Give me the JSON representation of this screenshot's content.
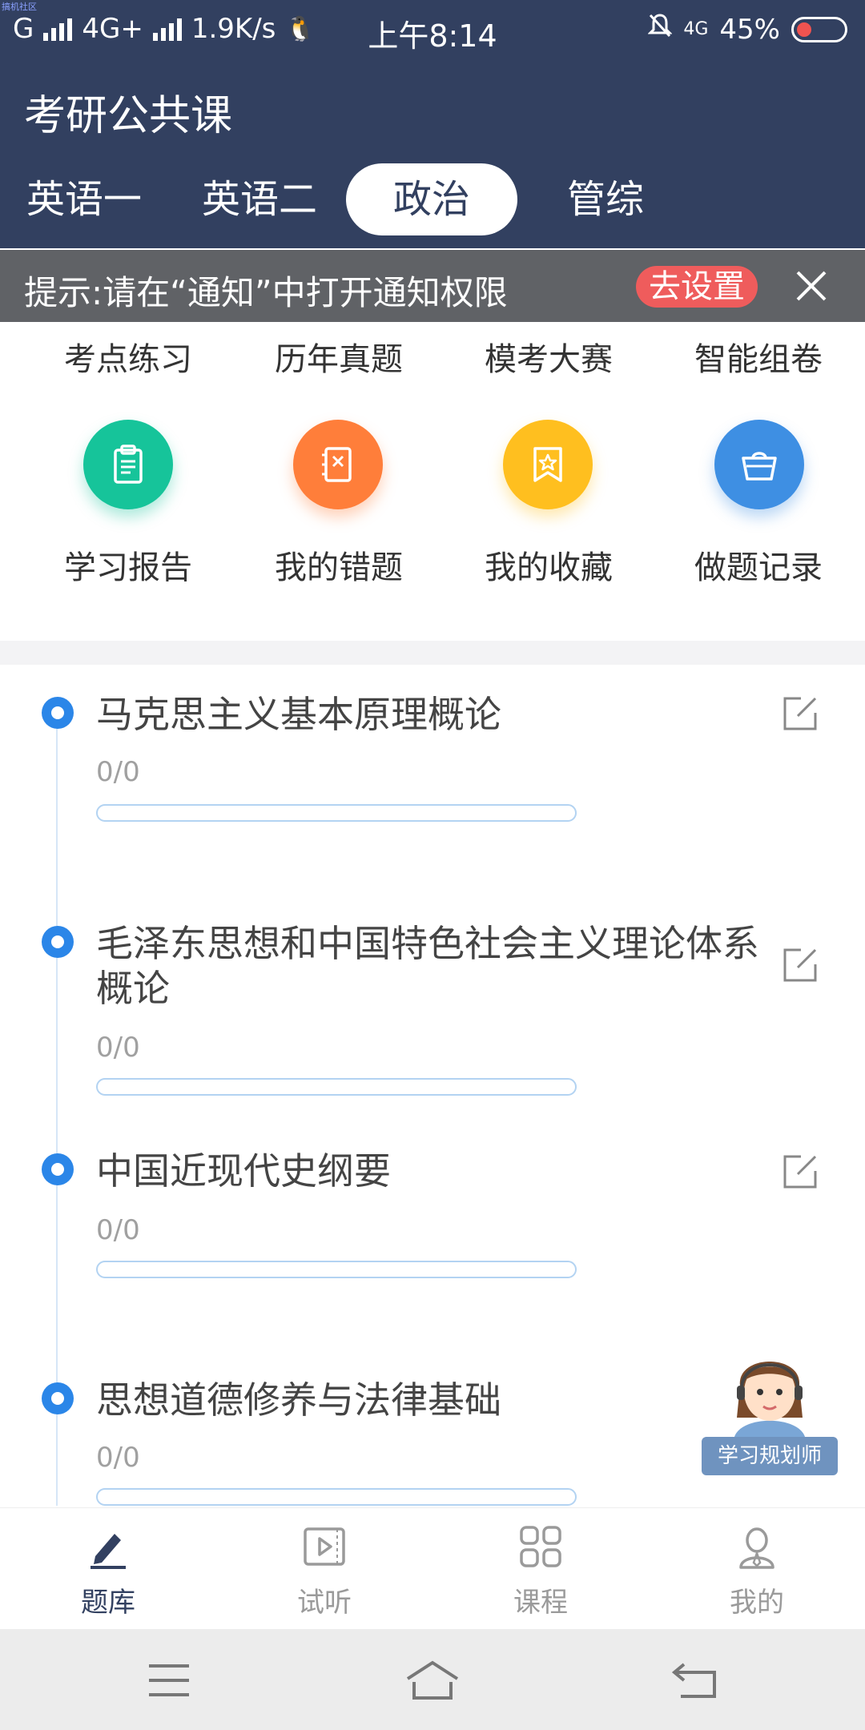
{
  "status_bar": {
    "watermark": "搞机社区",
    "carrier": "G",
    "network": "4G+",
    "speed": "1.9K/s",
    "time": "上午8:14",
    "net_type": "4G",
    "battery": "45%"
  },
  "header": {
    "title": "考研公共课",
    "tabs": [
      {
        "label": "英语一",
        "active": false
      },
      {
        "label": "英语二",
        "active": false
      },
      {
        "label": "政治",
        "active": true
      },
      {
        "label": "管综",
        "active": false
      }
    ]
  },
  "notice": {
    "text": "提示:请在“通知”中打开通知权限",
    "button": "去设置",
    "close_icon": "close-icon"
  },
  "quick_menu": {
    "top_row": [
      "考点练习",
      "历年真题",
      "模考大赛",
      "智能组卷"
    ],
    "items": [
      {
        "label": "学习报告",
        "icon": "clipboard-icon",
        "color": "#16c49a"
      },
      {
        "label": "我的错题",
        "icon": "notebook-icon",
        "color": "#ff7e3a"
      },
      {
        "label": "我的收藏",
        "icon": "star-bookmark-icon",
        "color": "#ffbf1f"
      },
      {
        "label": "做题记录",
        "icon": "basket-icon",
        "color": "#3e8fe3"
      }
    ]
  },
  "courses": [
    {
      "title": "马克思主义基本原理概论",
      "progress_text": "0/0",
      "progress": 0
    },
    {
      "title": "毛泽东思想和中国特色社会主义理论体系概论",
      "progress_text": "0/0",
      "progress": 0
    },
    {
      "title": "中国近现代史纲要",
      "progress_text": "0/0",
      "progress": 0
    },
    {
      "title": "思想道德修养与法律基础",
      "progress_text": "0/0",
      "progress": 0
    }
  ],
  "assistant": {
    "label": "学习规划师"
  },
  "bottom_nav": [
    {
      "label": "题库",
      "icon": "pencil-icon",
      "active": true
    },
    {
      "label": "试听",
      "icon": "play-video-icon",
      "active": false
    },
    {
      "label": "课程",
      "icon": "grid-icon",
      "active": false
    },
    {
      "label": "我的",
      "icon": "person-icon",
      "active": false
    }
  ],
  "colors": {
    "header_bg": "#324060",
    "accent_blue": "#2b86e8",
    "notice_bg": "#606266",
    "notice_button": "#ef5c5c"
  }
}
